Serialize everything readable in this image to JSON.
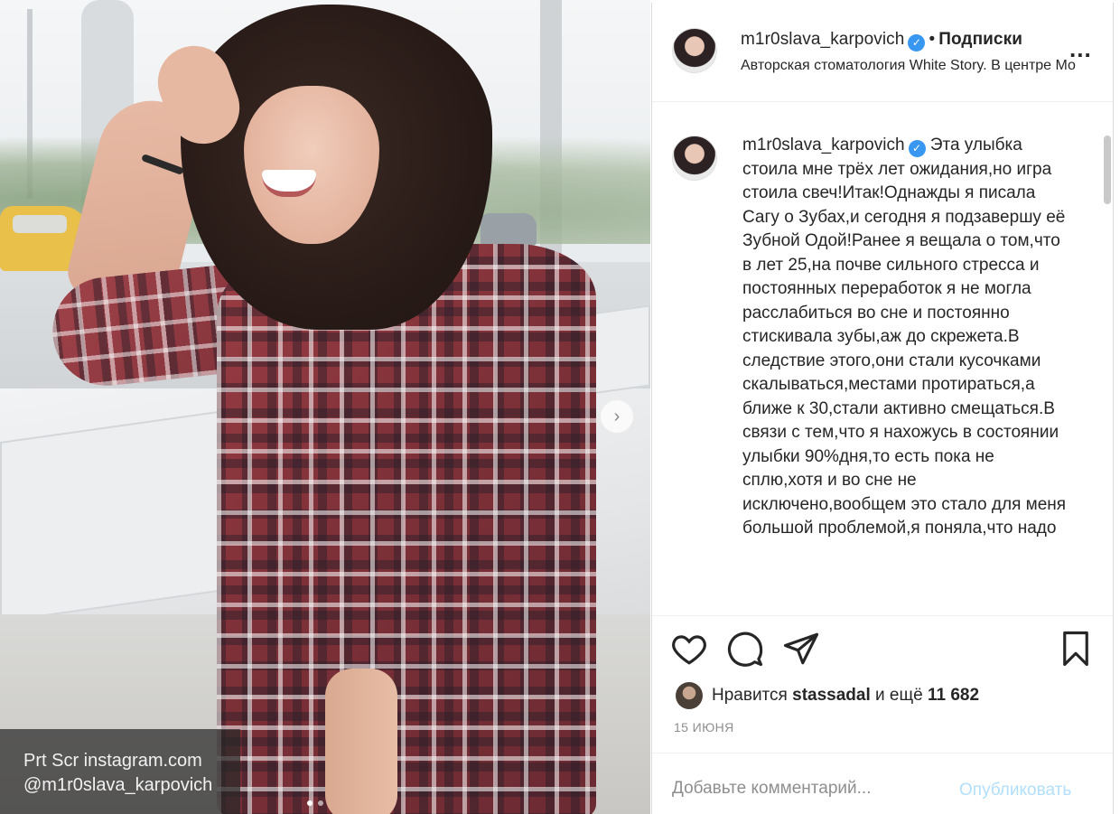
{
  "watermark": {
    "line1": "Prt Scr instagram.com",
    "line2": "@m1r0slava_karpovich"
  },
  "photo": {
    "next_glyph": "›",
    "dots_count": 2,
    "active_dot": 0
  },
  "header": {
    "username": "m1r0slava_karpovich",
    "verified_glyph": "✓",
    "separator": "•",
    "follow_label": "Подписки",
    "location": "Авторская стоматология White Story. В центре Мо",
    "more_glyph": "..."
  },
  "caption": {
    "username": "m1r0slava_karpovich",
    "text": "Эта улыбка стоила мне трёх лет ожидания,но игра стоила свеч!Итак!Однажды я писала Сагу о Зубах,и сегодня я подзавершу её Зубной Одой!Ранее я вещала о том,что в лет 25,на почве сильного стресса и постоянных переработок я не могла расслабиться во сне и постоянно стискивала зубы,аж до скрежета.В следствие этого,они стали кусочками скалываться,местами протираться,а ближе к 30,стали активно смещаться.В связи с тем,что я нахожусь в состоянии улыбки 90%дня,то есть пока не сплю,хотя и во сне не исключено,вообщем это стало для меня большой проблемой,я поняла,что надо"
  },
  "actions": {
    "like_icon": "heart-icon",
    "comment_icon": "comment-icon",
    "share_icon": "paper-plane-icon",
    "save_icon": "bookmark-icon"
  },
  "likes": {
    "prefix": "Нравится",
    "user": "stassadal",
    "middle": "и ещё",
    "count": "11 682"
  },
  "date": "15 ИЮНЯ",
  "comment": {
    "placeholder": "Добавьте комментарий...",
    "publish_label": "Опубликовать"
  },
  "colors": {
    "verified": "#3897f0",
    "publish_disabled": "#b2dffc",
    "text": "#262626",
    "muted": "#8e8e8e"
  }
}
